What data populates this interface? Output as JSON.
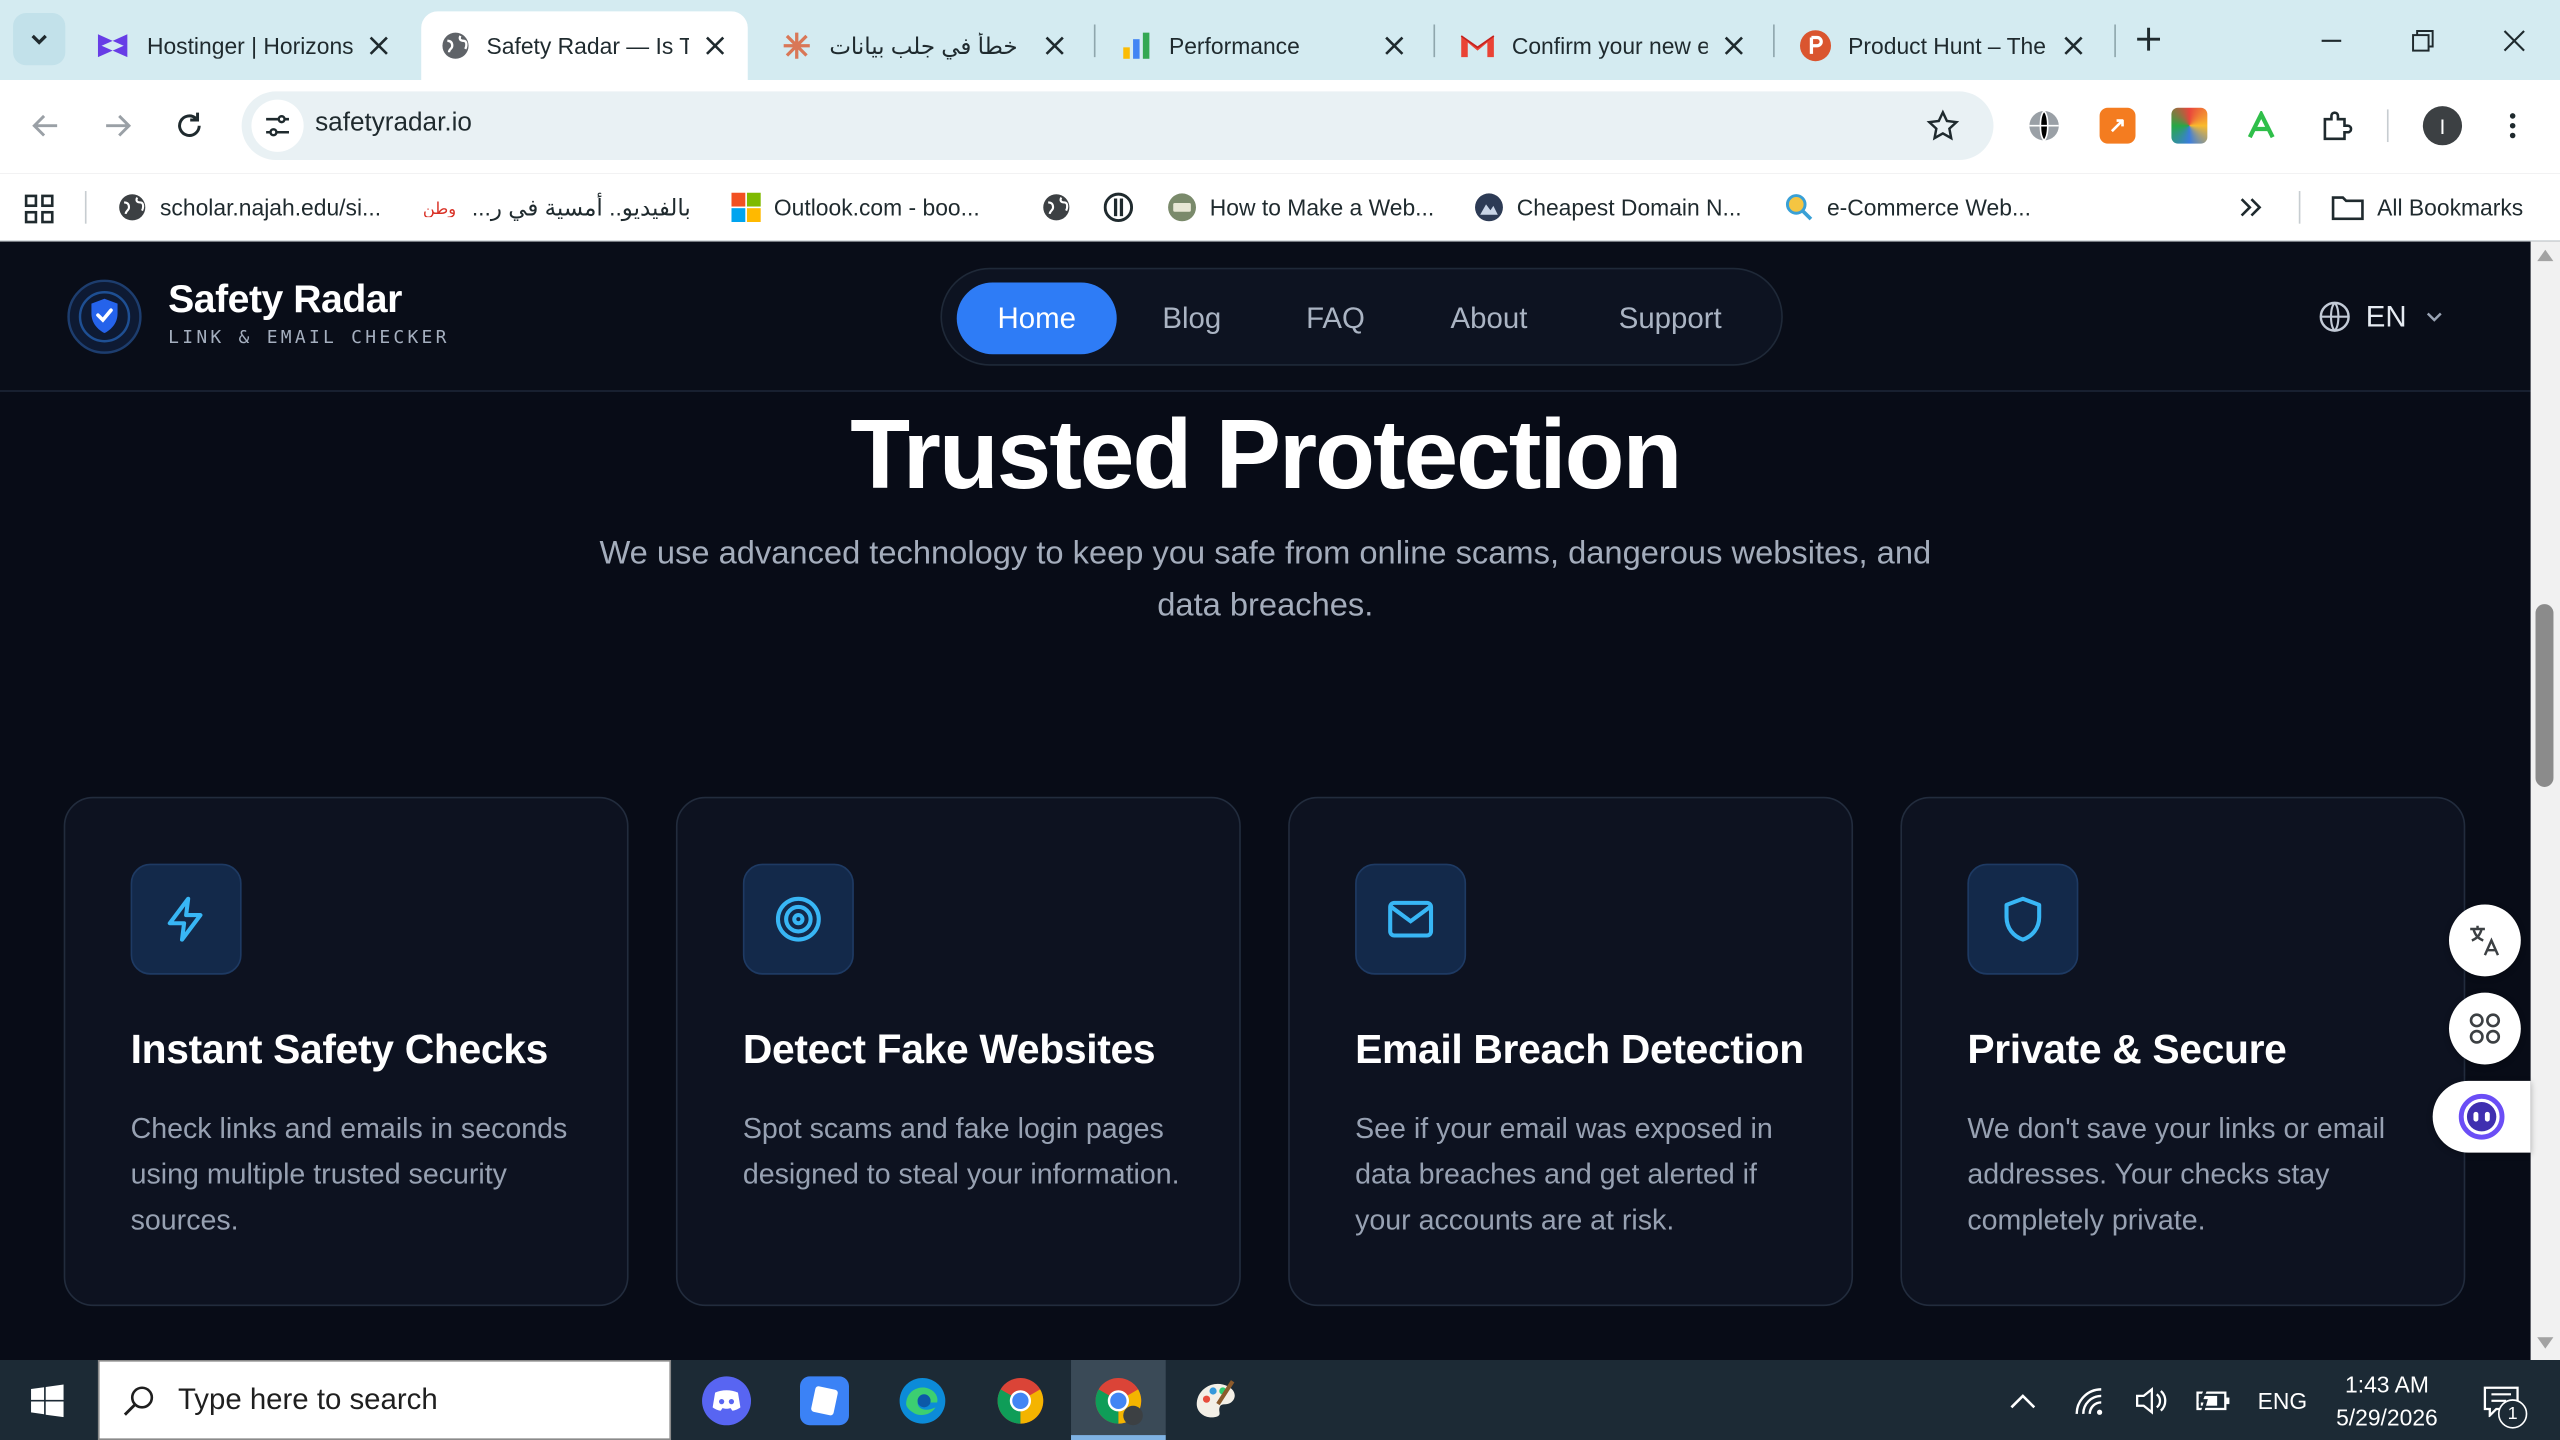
{
  "browser": {
    "tabs": [
      {
        "title": "Hostinger | Horizons",
        "icon": "hostinger-icon"
      },
      {
        "title": "Safety Radar — Is This Link Safe?",
        "icon": "globe-icon",
        "active": true
      },
      {
        "title": "خطأ في جلب بيانات",
        "icon": "claude-icon"
      },
      {
        "title": "Performance",
        "icon": "analytics-icon"
      },
      {
        "title": "Confirm your new email",
        "icon": "gmail-icon"
      },
      {
        "title": "Product Hunt – The best new products",
        "icon": "producthunt-icon"
      }
    ],
    "url": "safetyradar.io",
    "profile_initial": "I",
    "bookmarks": [
      {
        "label": "scholar.najah.edu/si..."
      },
      {
        "label": "بالفيديو.. أمسية في ر..."
      },
      {
        "label": "Outlook.com - boo..."
      },
      {
        "label": ""
      },
      {
        "label": ""
      },
      {
        "label": "How to Make a Web..."
      },
      {
        "label": "Cheapest Domain N..."
      },
      {
        "label": "e-Commerce Web..."
      }
    ],
    "all_bookmarks_label": "All Bookmarks"
  },
  "site": {
    "logo_title": "Safety Radar",
    "logo_subtitle": "LINK & EMAIL CHECKER",
    "nav": [
      {
        "label": "Home",
        "active": true
      },
      {
        "label": "Blog"
      },
      {
        "label": "FAQ"
      },
      {
        "label": "About"
      },
      {
        "label": "Support"
      }
    ],
    "language": "EN",
    "heading": "Trusted Protection",
    "subheading_line1": "We use advanced technology to keep you safe from online scams, dangerous websites, and",
    "subheading_line2": "data breaches.",
    "features": [
      {
        "icon": "lightning-icon",
        "title": "Instant Safety Checks",
        "text": "Check links and emails in seconds using multiple trusted security sources."
      },
      {
        "icon": "target-icon",
        "title": "Detect Fake Websites",
        "text": "Spot scams and fake login pages designed to steal your information."
      },
      {
        "icon": "mail-icon",
        "title": "Email Breach Detection",
        "text": "See if your email was exposed in data breaches and get alerted if your accounts are at risk."
      },
      {
        "icon": "shield-icon",
        "title": "Private & Secure",
        "text": "We don't save your links or email addresses. Your checks stay completely private."
      }
    ],
    "accent_color": "#2e7cf6",
    "icon_color": "#38b6f5"
  },
  "taskbar": {
    "search_placeholder": "Type here to search",
    "language": "ENG",
    "time": "1:43 AM",
    "date": "5/29/2026",
    "notification_count": "1"
  }
}
